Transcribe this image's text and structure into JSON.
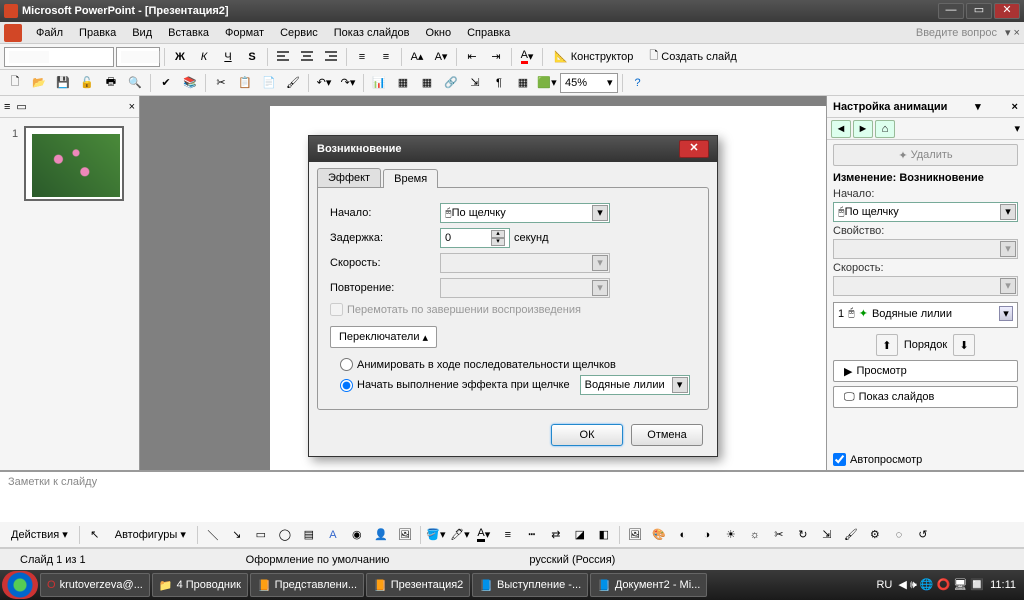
{
  "titlebar": {
    "title": "Microsoft PowerPoint - [Презентация2]"
  },
  "menu": {
    "file": "Файл",
    "edit": "Правка",
    "view": "Вид",
    "insert": "Вставка",
    "format": "Формат",
    "tools": "Сервис",
    "slideshow": "Показ слайдов",
    "window": "Окно",
    "help": "Справка",
    "question_hint": "Введите вопрос"
  },
  "toolbar1": {
    "designer": "Конструктор",
    "new_slide": "Создать слайд"
  },
  "toolbar2": {
    "zoom": "45%"
  },
  "slidepanel": {
    "slide_num": "1"
  },
  "taskpane": {
    "title": "Настройка анимации",
    "delete": "Удалить",
    "change_label": "Изменение: Возникновение",
    "start_label": "Начало:",
    "start_value": "По щелчку",
    "property_label": "Свойство:",
    "speed_label": "Скорость:",
    "list_item_num": "1",
    "list_item_name": "Водяные лилии",
    "order_label": "Порядок",
    "preview": "Просмотр",
    "slideshow": "Показ слайдов",
    "autopreview": "Автопросмотр"
  },
  "dialog": {
    "title": "Возникновение",
    "tab_effect": "Эффект",
    "tab_timing": "Время",
    "start_label": "Начало:",
    "start_value": "По щелчку",
    "delay_label": "Задержка:",
    "delay_value": "0",
    "delay_unit": "секунд",
    "speed_label": "Скорость:",
    "repeat_label": "Повторение:",
    "rewind": "Перемотать по завершении воспроизведения",
    "triggers_btn": "Переключатели",
    "radio_seq": "Анимировать в ходе последовательности щелчков",
    "radio_click": "Начать выполнение эффекта при щелчке",
    "trigger_target": "Водяные лилии",
    "ok": "ОК",
    "cancel": "Отмена"
  },
  "notes": {
    "placeholder": "Заметки к слайду"
  },
  "bottom_toolbar": {
    "actions": "Действия",
    "autoshapes": "Автофигуры"
  },
  "status": {
    "slide": "Слайд 1 из 1",
    "design": "Оформление по умолчанию",
    "lang": "русский (Россия)"
  },
  "taskbar": {
    "items": [
      "krutoverzeva@...",
      "4 Проводник",
      "Представлени...",
      "Презентация2",
      "Выступление -...",
      "Документ2 - Mi..."
    ],
    "lang": "RU",
    "time": "11:11"
  }
}
